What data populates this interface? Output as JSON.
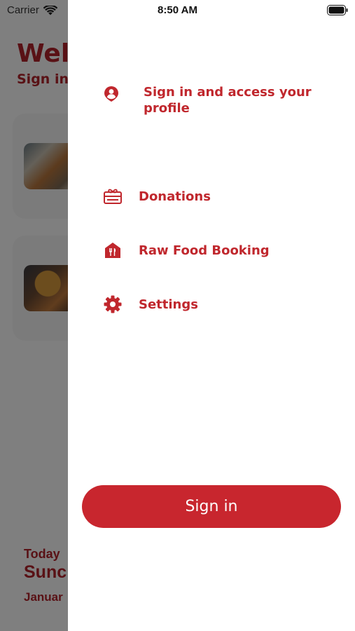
{
  "status_bar": {
    "carrier": "Carrier",
    "time": "8:50 AM"
  },
  "background": {
    "title": "Wel",
    "subtitle": "Sign in",
    "today_label": "Today",
    "day": "Sunc",
    "date": "Januar"
  },
  "drawer": {
    "items": [
      {
        "label": "Sign in and access your profile",
        "icon": "user-circle-icon"
      },
      {
        "label": "Donations",
        "icon": "gift-card-icon"
      },
      {
        "label": "Raw Food Booking",
        "icon": "store-utensils-icon"
      },
      {
        "label": "Settings",
        "icon": "gear-icon"
      }
    ],
    "signin_button": "Sign in"
  },
  "colors": {
    "accent": "#c0272d",
    "button": "#c8262e",
    "overlay": "rgba(0,0,0,0.5)"
  }
}
